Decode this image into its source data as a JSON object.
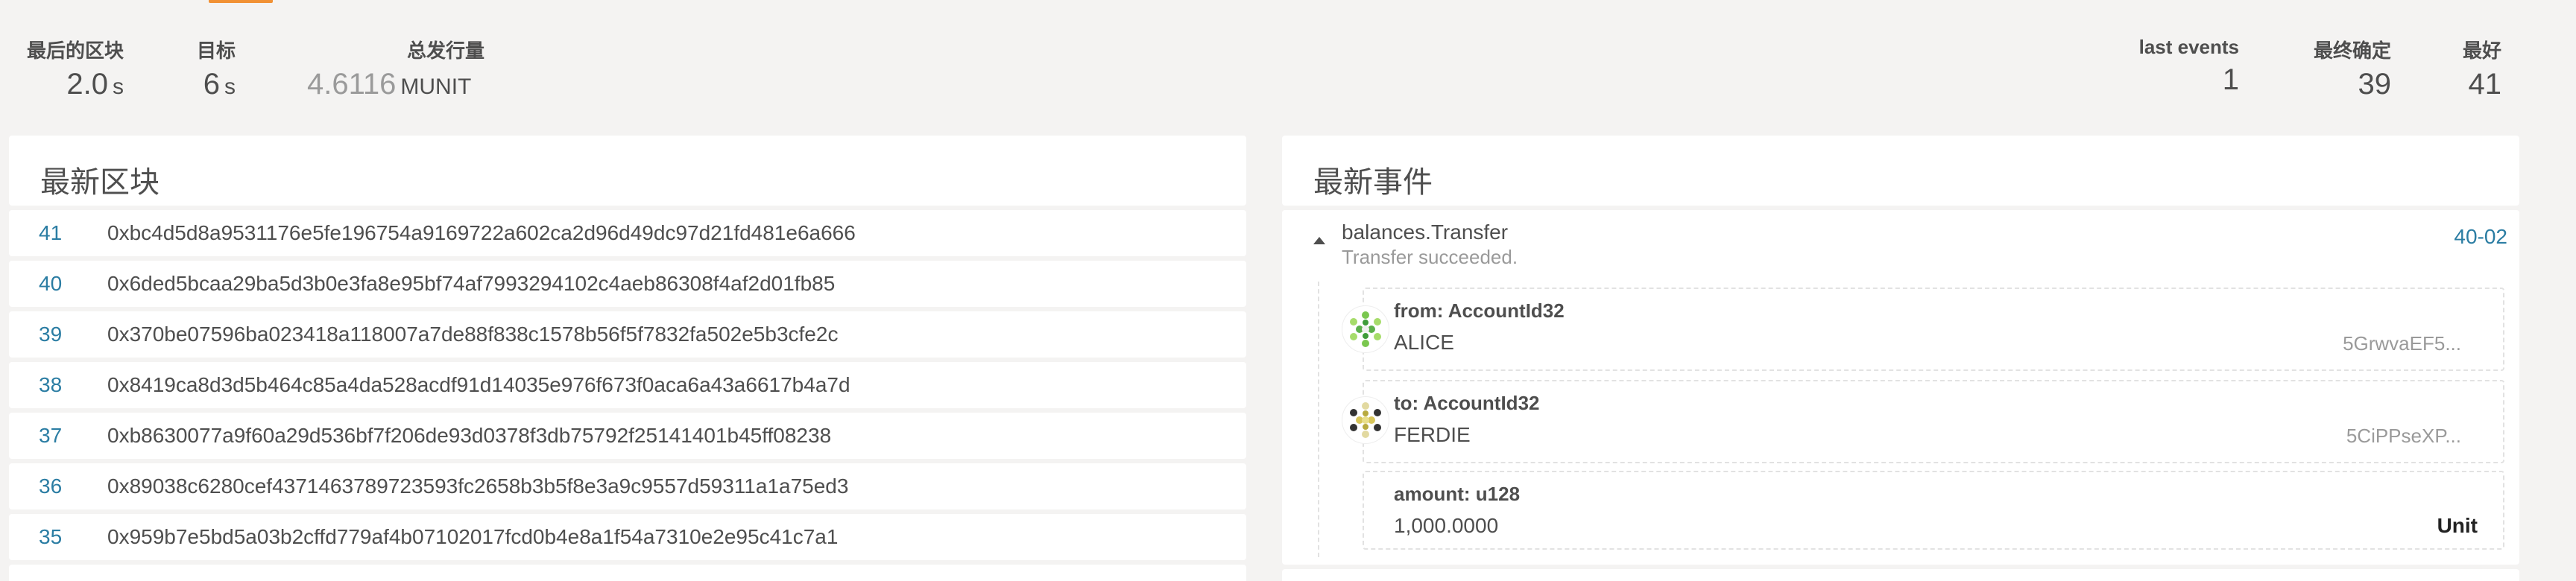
{
  "summary": {
    "last_block": {
      "label": "最后的区块",
      "value": "2.0",
      "unit": "s"
    },
    "target": {
      "label": "目标",
      "value": "6",
      "unit": "s"
    },
    "issuance": {
      "label": "总发行量",
      "value_int": "4.",
      "value_dec": "6116",
      "unit": "MUNIT"
    },
    "last_events": {
      "label": "last events",
      "value": "1"
    },
    "finalized": {
      "label": "最终确定",
      "value": "39"
    },
    "best": {
      "label": "最好",
      "value": "41"
    }
  },
  "blocks": {
    "title": "最新区块",
    "rows": [
      {
        "number": "41",
        "hash": "0xbc4d5d8a9531176e5fe196754a9169722a602ca2d96d49dc97d21fd481e6a666"
      },
      {
        "number": "40",
        "hash": "0x6ded5bcaa29ba5d3b0e3fa8e95bf74af7993294102c4aeb86308f4af2d01fb85"
      },
      {
        "number": "39",
        "hash": "0x370be07596ba023418a118007a7de88f838c1578b56f5f7832fa502e5b3cfe2c"
      },
      {
        "number": "38",
        "hash": "0x8419ca8d3d5b464c85a4da528acdf91d14035e976f673f0aca6a43a6617b4a7d"
      },
      {
        "number": "37",
        "hash": "0xb8630077a9f60a29d536bf7f206de93d0378f3db75792f25141401b45ff08238"
      },
      {
        "number": "36",
        "hash": "0x89038c6280cef4371463789723593fc2658b3b5f8e3a9c9557d59311a1a75ed3"
      },
      {
        "number": "35",
        "hash": "0x959b7e5bd5a03b2cffd779af4b07102017fcd0b4e8a1f54a7310e2e95c41c7a1"
      }
    ]
  },
  "events": {
    "title": "最新事件",
    "item": {
      "name": "balances.Transfer",
      "description": "Transfer succeeded.",
      "link": "40-02",
      "params": [
        {
          "label": "from: AccountId32",
          "value": "ALICE",
          "address": "5GrwvaEF5..."
        },
        {
          "label": "to: AccountId32",
          "value": "FERDIE",
          "address": "5CiPPseXP..."
        },
        {
          "label": "amount: u128",
          "value": "1,000.0000",
          "unit": "Unit"
        }
      ]
    }
  },
  "colors": {
    "accent": "#f19135",
    "link": "#2b7da3",
    "background": "#f4f3f2"
  }
}
